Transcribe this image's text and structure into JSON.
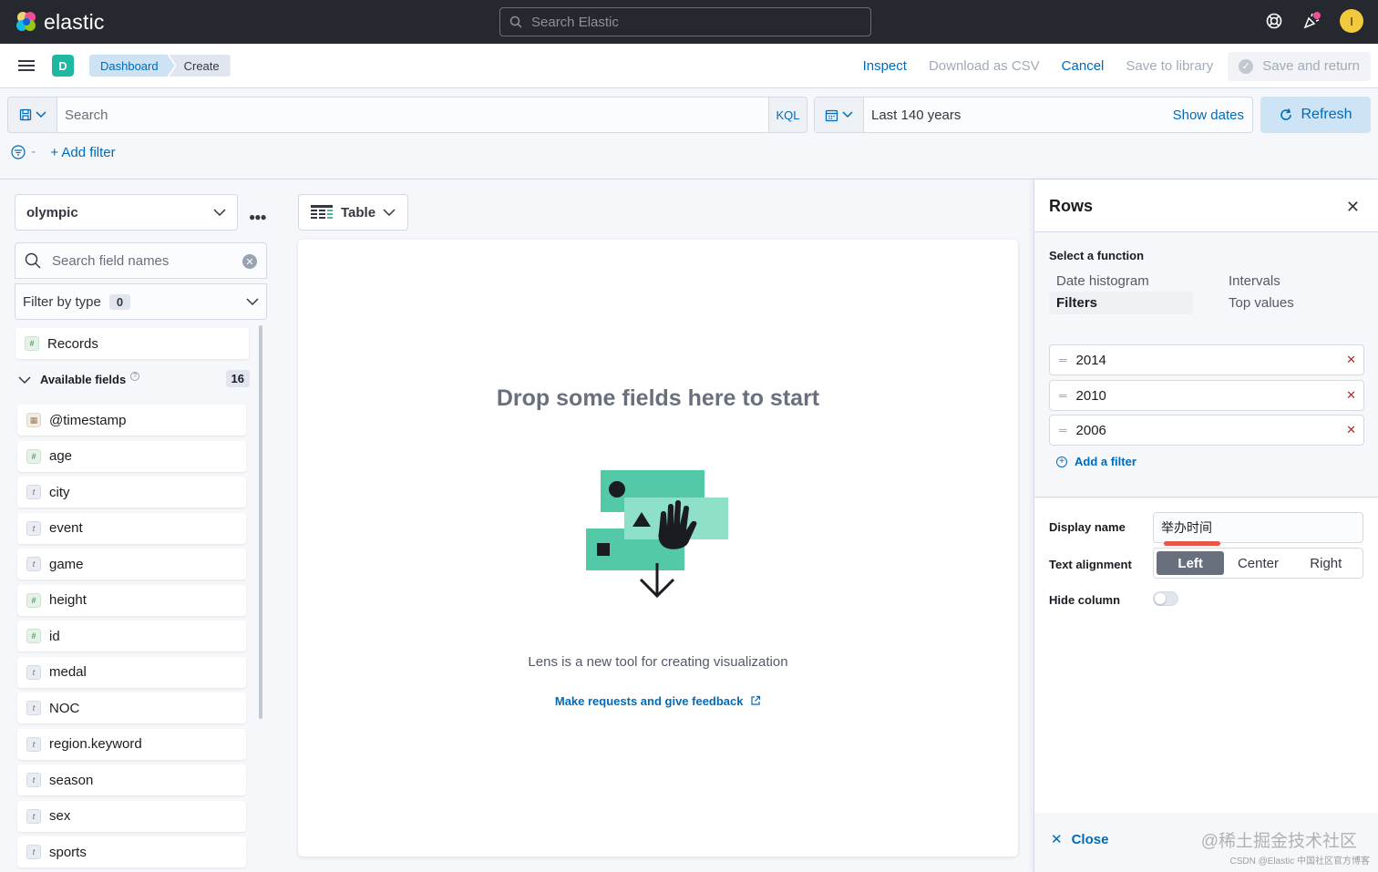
{
  "topbar": {
    "brand": "elastic",
    "search_placeholder": "Search Elastic",
    "avatar_initial": "I",
    "accent": "#f0c93c"
  },
  "header": {
    "app_badge": "D",
    "breadcrumbs": [
      "Dashboard",
      "Create"
    ],
    "actions": {
      "inspect": "Inspect",
      "download_csv": "Download as CSV",
      "cancel": "Cancel",
      "save_library": "Save to library",
      "save_return": "Save and return"
    }
  },
  "query": {
    "search_placeholder": "Search",
    "language": "KQL",
    "date_range": "Last 140 years",
    "show_dates": "Show dates",
    "refresh": "Refresh",
    "add_filter": "+ Add filter"
  },
  "sidebar": {
    "index_pattern": "olympic",
    "field_search_placeholder": "Search field names",
    "filter_by_type": "Filter by type",
    "filter_count": "0",
    "records": "Records",
    "available_fields_label": "Available fields",
    "available_count": "16",
    "fields": [
      {
        "name": "@timestamp",
        "type": "date"
      },
      {
        "name": "age",
        "type": "number"
      },
      {
        "name": "city",
        "type": "string"
      },
      {
        "name": "event",
        "type": "string"
      },
      {
        "name": "game",
        "type": "string"
      },
      {
        "name": "height",
        "type": "number"
      },
      {
        "name": "id",
        "type": "number"
      },
      {
        "name": "medal",
        "type": "string"
      },
      {
        "name": "NOC",
        "type": "string"
      },
      {
        "name": "region.keyword",
        "type": "string"
      },
      {
        "name": "season",
        "type": "string"
      },
      {
        "name": "sex",
        "type": "string"
      },
      {
        "name": "sports",
        "type": "string"
      }
    ]
  },
  "workspace": {
    "chart_type": "Table",
    "drop_title": "Drop some fields here to start",
    "description": "Lens is a new tool for creating visualization",
    "feedback_link": "Make requests and give feedback"
  },
  "flyout": {
    "title": "Rows",
    "select_function_label": "Select a function",
    "functions": {
      "date_histogram": "Date histogram",
      "intervals": "Intervals",
      "filters": "Filters",
      "top_values": "Top values"
    },
    "active_function": "Filters",
    "filters": [
      "2014",
      "2010",
      "2006"
    ],
    "add_filter": "Add a filter",
    "display_name_label": "Display name",
    "display_name_value": "举办时间",
    "text_alignment_label": "Text alignment",
    "alignment_options": [
      "Left",
      "Center",
      "Right"
    ],
    "alignment_selected": "Left",
    "hide_column_label": "Hide column",
    "hide_column": false,
    "close": "Close"
  },
  "watermark": {
    "main": "@稀土掘金技术社区",
    "sub": "CSDN @Elastic 中国社区官方博客"
  }
}
